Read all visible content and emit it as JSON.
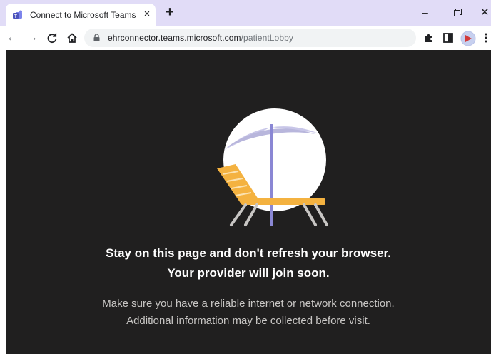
{
  "browser": {
    "tab": {
      "title": "Connect to Microsoft Teams",
      "close_glyph": "×",
      "favicon": "teams-icon"
    },
    "new_tab_glyph": "+",
    "window_controls": {
      "minimize": "–",
      "close": "✕"
    },
    "address_bar": {
      "host": "ehrconnector.teams.microsoft.com",
      "path": "/patientLobby"
    },
    "nav": {
      "back": "←",
      "forward": "→",
      "reload": "C"
    }
  },
  "lobby": {
    "headline_1": "Stay on this page and don't refresh your browser.",
    "headline_2": "Your provider will join soon.",
    "message_1": "Make sure you have a reliable internet or network connection.",
    "message_2": "Additional information may be collected before visit.",
    "illustration": "beach-chair-umbrella-icon"
  },
  "colors": {
    "tabstrip": "#e1dcf7",
    "content_bg": "#201f1f",
    "chair": "#f4b240",
    "umbrella": "#c8c6e8",
    "pole": "#8a87d4"
  }
}
